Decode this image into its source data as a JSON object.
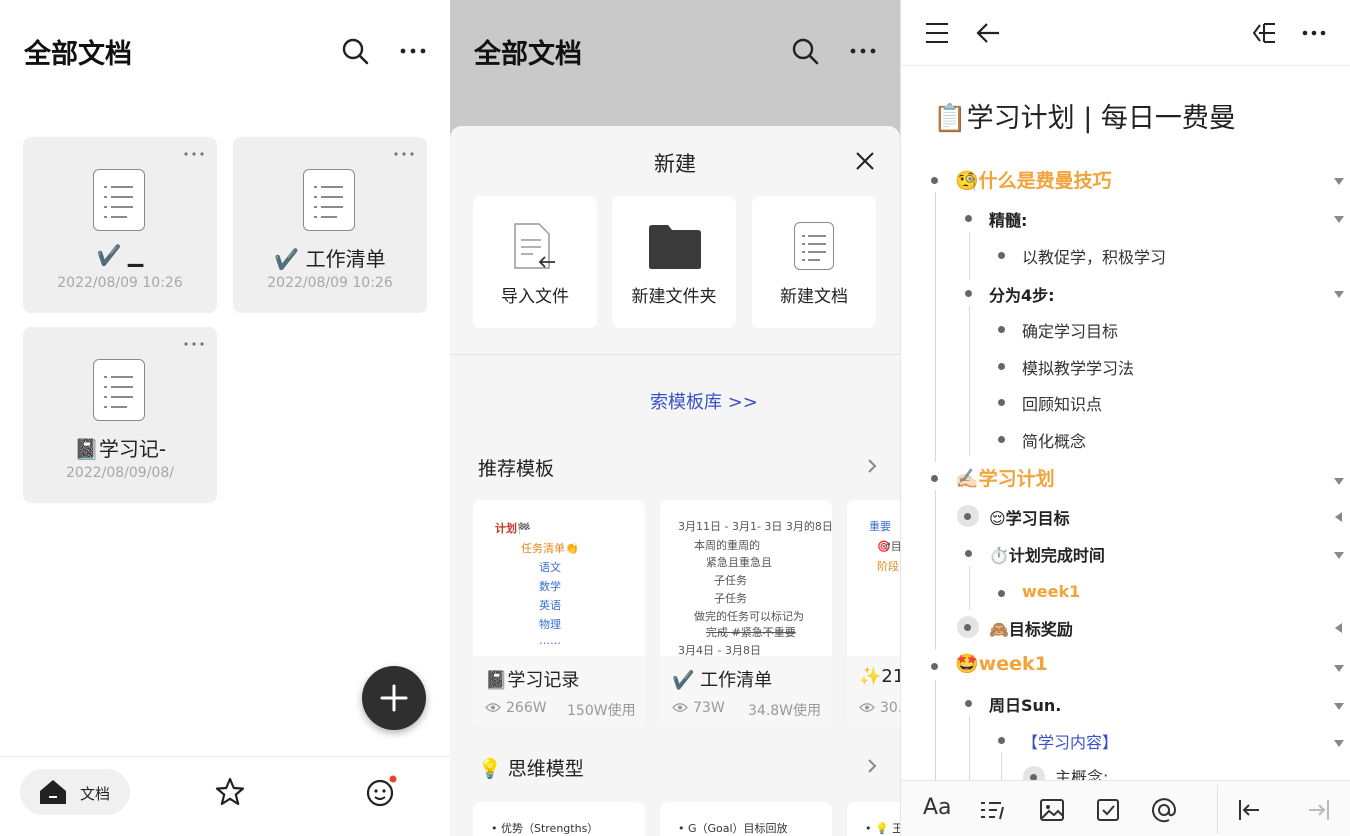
{
  "left_panel": {
    "title": "全部文档",
    "cards": [
      {
        "name": "✔️ ▁",
        "date": "2022/08/09 10:26"
      },
      {
        "name": "✔️ 工作清单",
        "date": "2022/08/09 10:26"
      },
      {
        "name": "📓学习记-",
        "date": "2022/08/09/08/"
      }
    ],
    "nav": {
      "docs_label": "文档"
    }
  },
  "middle_panel": {
    "title": "全部文档",
    "sheet_title": "新建",
    "actions": [
      {
        "label": "导入文件"
      },
      {
        "label": "新建文件夹"
      },
      {
        "label": "新建文档"
      }
    ],
    "template_link": "索模板库 >>",
    "recommended_label": "推荐模板",
    "templates": [
      {
        "name": "📓学习记录",
        "views": "266W",
        "uses": "150W使用"
      },
      {
        "name": "✔️ 工作清单",
        "views": "73W",
        "uses": "34.8W使用"
      },
      {
        "name": "✨21",
        "views": "30.",
        "uses": ""
      }
    ],
    "preview1": [
      "计划🏁",
      "任务清单👏",
      "语文",
      "数学",
      "英语",
      "物理",
      "……"
    ],
    "preview2": [
      "3月11日 - 3月1- 3日 3月的8日",
      "本周的重周的",
      "紧急且重急且",
      "子任务",
      "子任务",
      "做完的任务可以标记为",
      "完成 #紧急不重要",
      "3月4日 - 3月8日"
    ],
    "preview3": [
      "重要",
      "🎯目",
      "阶段"
    ],
    "thinking_label": "💡 思维模型",
    "bottom_previews": [
      "• 优势（Strengths）",
      "• G（Goal）目标回放",
      "• 💡 王"
    ]
  },
  "right_panel": {
    "doc_title": "📋学习计划 | 每日一费曼",
    "outline": [
      {
        "text": "🧐什么是费曼技巧",
        "level": 1
      },
      {
        "text": "精髓:",
        "level": 2
      },
      {
        "text": "以教促学，积极学习",
        "level": 3
      },
      {
        "text": "分为4步:",
        "level": 2
      },
      {
        "text": "确定学习目标",
        "level": 3
      },
      {
        "text": "模拟教学学习法",
        "level": 3
      },
      {
        "text": "回顾知识点",
        "level": 3
      },
      {
        "text": "简化概念",
        "level": 3
      },
      {
        "text": "✍🏻学习计划",
        "level": 1
      },
      {
        "text": "😌学习目标",
        "level": 2
      },
      {
        "text": "⏱️计划完成时间",
        "level": 2
      },
      {
        "text": "week1",
        "level": 3
      },
      {
        "text": "🙈目标奖励",
        "level": 2
      },
      {
        "text": "🤩week1",
        "level": 1
      },
      {
        "text": "周日Sun.",
        "level": 2
      },
      {
        "text": "【学习内容】",
        "level": 3
      },
      {
        "text": "主概念:",
        "level": 4
      }
    ],
    "toolbar_font_label": "Aa"
  },
  "colors": {
    "accent_orange": "#f2a33a",
    "link_blue": "#3a52c4",
    "fab": "#2f2f2f"
  }
}
